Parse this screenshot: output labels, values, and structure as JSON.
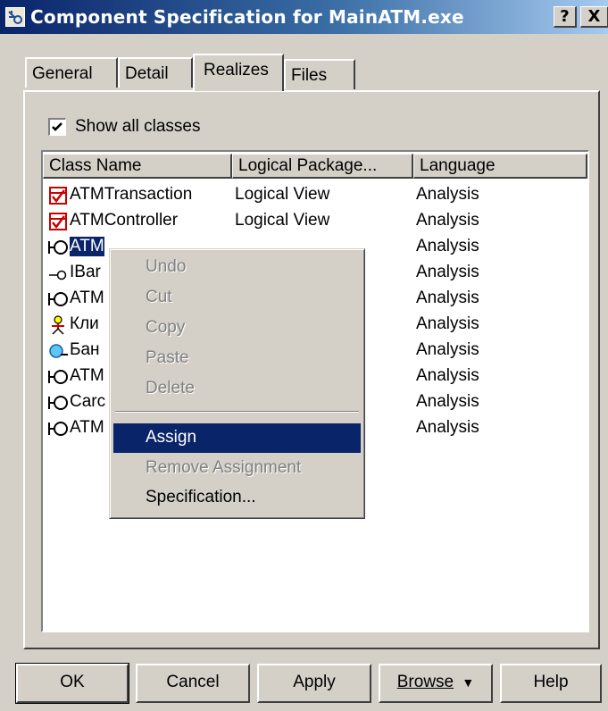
{
  "window": {
    "title": "Component Specification for MainATM.exe",
    "help_btn": "?",
    "close_btn": "X"
  },
  "tabs": [
    {
      "label": "General"
    },
    {
      "label": "Detail"
    },
    {
      "label": "Realizes",
      "active": true
    },
    {
      "label": "Files"
    }
  ],
  "show_all": {
    "label": "Show all classes",
    "checked": true
  },
  "list": {
    "columns": [
      "Class Name",
      "Logical Package...",
      "Language"
    ],
    "rows": [
      {
        "icon": "class-checked-icon",
        "name": "ATMTransaction",
        "package": "Logical View",
        "language": "Analysis"
      },
      {
        "icon": "class-checked-icon",
        "name": "ATMController",
        "package": "Logical View",
        "language": "Analysis"
      },
      {
        "icon": "boundary-icon",
        "name": "ATM",
        "package": "",
        "language": "Analysis",
        "selected": true
      },
      {
        "icon": "interface-icon",
        "name": "IBar",
        "package": "",
        "language": "Analysis"
      },
      {
        "icon": "boundary-icon",
        "name": "ATM",
        "package": "",
        "language": "Analysis"
      },
      {
        "icon": "actor-icon",
        "name": "Кли",
        "package": "",
        "language": "Analysis"
      },
      {
        "icon": "entity-icon",
        "name": "Бан",
        "package": "",
        "language": "Analysis"
      },
      {
        "icon": "boundary-icon",
        "name": "ATM",
        "package": "",
        "language": "Analysis"
      },
      {
        "icon": "boundary-icon",
        "name": "Carc",
        "package": "",
        "language": "Analysis"
      },
      {
        "icon": "boundary-icon",
        "name": "ATM",
        "package": "",
        "language": "Analysis"
      }
    ]
  },
  "context_menu": {
    "items": [
      {
        "label": "Undo",
        "enabled": false
      },
      {
        "label": "Cut",
        "enabled": false
      },
      {
        "label": "Copy",
        "enabled": false
      },
      {
        "label": "Paste",
        "enabled": false
      },
      {
        "label": "Delete",
        "enabled": false
      },
      {
        "label": "Assign",
        "enabled": true,
        "highlighted": true
      },
      {
        "label": "Remove Assignment",
        "enabled": false
      },
      {
        "label": "Specification...",
        "enabled": true
      }
    ]
  },
  "buttons": {
    "ok": "OK",
    "cancel": "Cancel",
    "apply": "Apply",
    "browse": "Browse",
    "browse_arrow": "▼",
    "help": "Help"
  },
  "colors": {
    "face": "#d4d0c8",
    "title_start": "#0a246a",
    "title_end": "#a6caf0",
    "selection": "#0a246a"
  }
}
